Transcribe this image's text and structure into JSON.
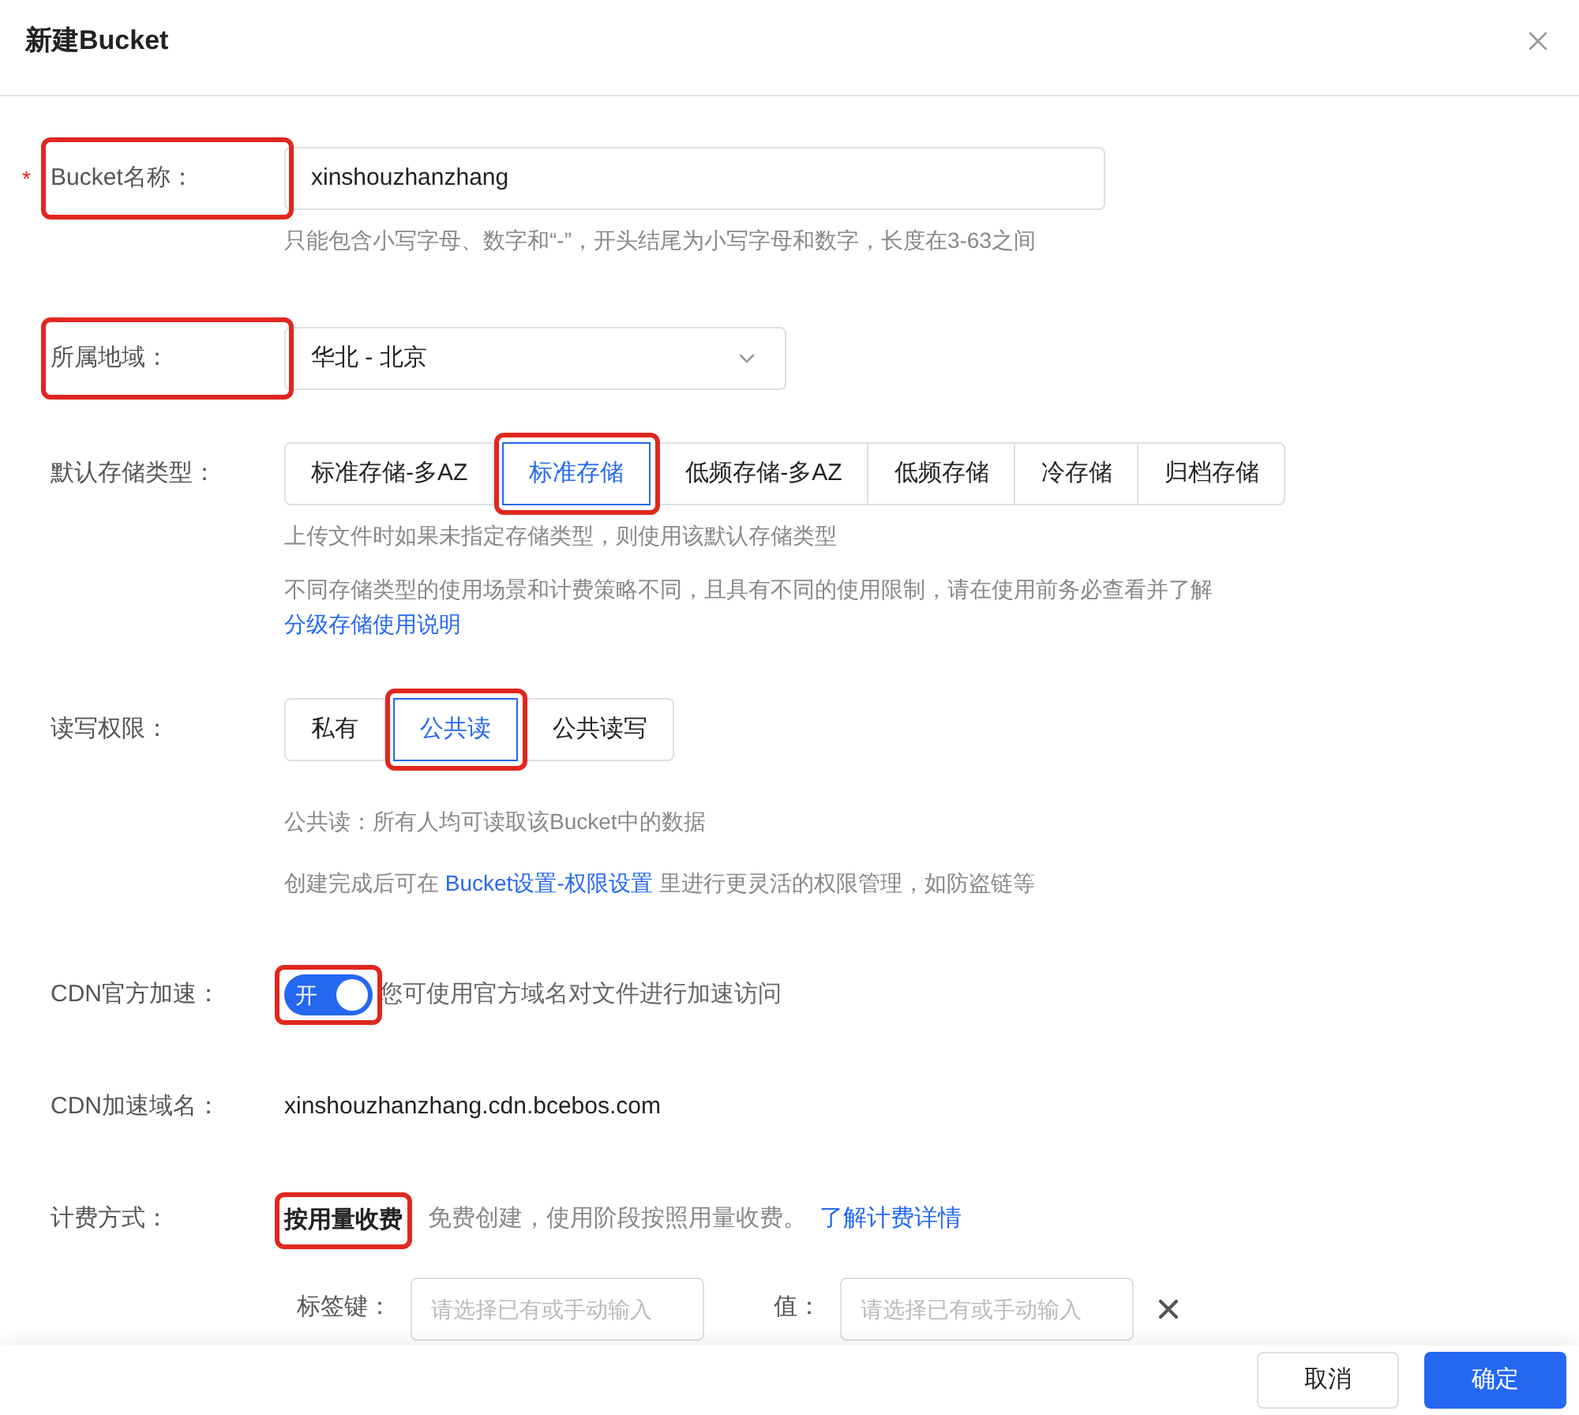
{
  "dialog": {
    "title": "新建Bucket"
  },
  "bucket_name": {
    "label": "Bucket名称：",
    "required": true,
    "required_mark": "*",
    "value": "xinshouzhanzhang",
    "hint": "只能包含小写字母、数字和“-”，开头结尾为小写字母和数字，长度在3-63之间",
    "highlighted": true
  },
  "region": {
    "label": "所属地域：",
    "value": "华北 - 北京",
    "highlighted": true
  },
  "storage_class": {
    "label": "默认存储类型：",
    "options": [
      {
        "label": "标准存储-多AZ",
        "selected": false,
        "highlighted": false
      },
      {
        "label": "标准存储",
        "selected": true,
        "highlighted": true
      },
      {
        "label": "低频存储-多AZ",
        "selected": false,
        "highlighted": false
      },
      {
        "label": "低频存储",
        "selected": false,
        "highlighted": false
      },
      {
        "label": "冷存储",
        "selected": false,
        "highlighted": false
      },
      {
        "label": "归档存储",
        "selected": false,
        "highlighted": false
      }
    ],
    "hint": "上传文件时如果未指定存储类型，则使用该默认存储类型",
    "note": "不同存储类型的使用场景和计费策略不同，且具有不同的使用限制，请在使用前务必查看并了解",
    "note_link": "分级存储使用说明"
  },
  "permission": {
    "label": "读写权限：",
    "options": [
      {
        "label": "私有",
        "selected": false,
        "highlighted": false
      },
      {
        "label": "公共读",
        "selected": true,
        "highlighted": true
      },
      {
        "label": "公共读写",
        "selected": false,
        "highlighted": false
      }
    ],
    "hint": "公共读：所有人均可读取该Bucket中的数据",
    "note_before": "创建完成后可在",
    "note_link": "Bucket设置-权限设置",
    "note_after": "里进行更灵活的权限管理，如防盗链等"
  },
  "cdn": {
    "label": "CDN官方加速：",
    "on": true,
    "switch_text": "开",
    "description": "您可使用官方域名对文件进行加速访问",
    "highlighted": true
  },
  "cdn_domain": {
    "label": "CDN加速域名：",
    "value": "xinshouzhanzhang.cdn.bcebos.com"
  },
  "billing": {
    "label": "计费方式：",
    "value": "按用量收费",
    "description": "免费创建，使用阶段按照用量收费。",
    "link": "了解计费详情",
    "highlighted": true
  },
  "tags": {
    "key_label": "标签键：",
    "key_placeholder": "请选择已有或手动输入",
    "value_label": "值：",
    "value_placeholder": "请选择已有或手动输入"
  },
  "footer": {
    "buttons": [
      {
        "label": "取消",
        "kind": "secondary"
      },
      {
        "label": "确定",
        "kind": "primary"
      }
    ]
  }
}
